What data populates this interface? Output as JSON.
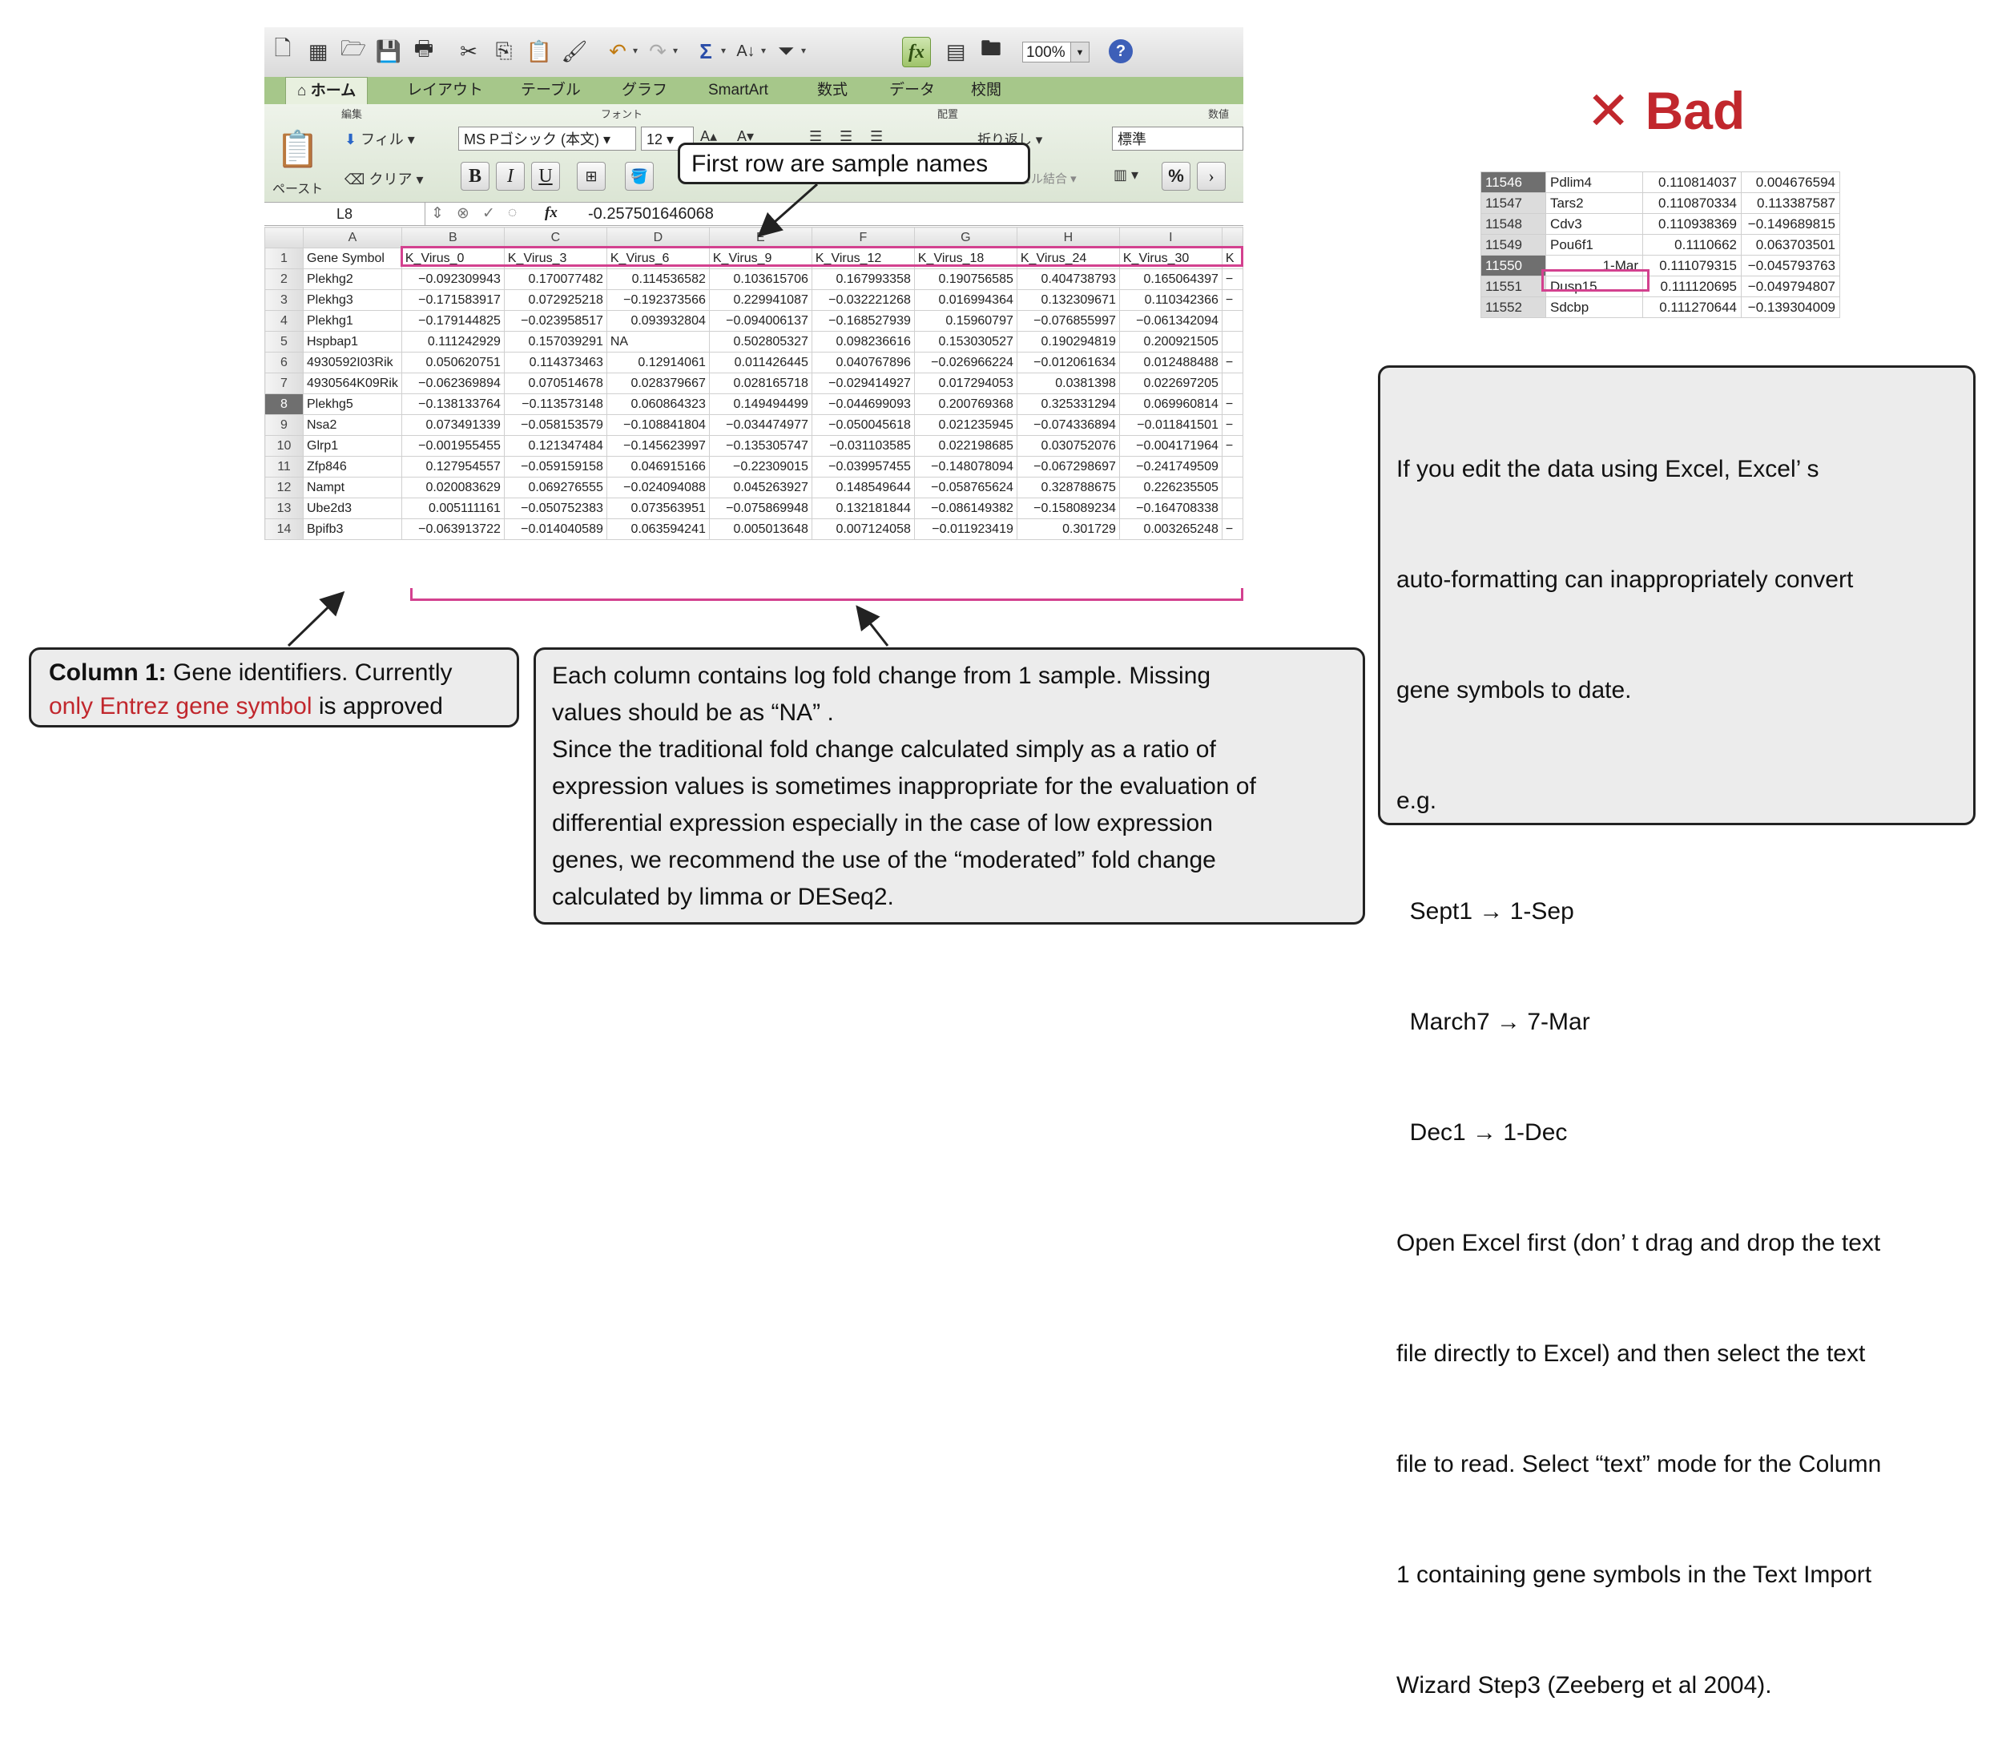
{
  "toolbar": {
    "zoom_value": "100%",
    "icons": [
      "new-icon",
      "gallery-icon",
      "open-icon",
      "save-icon",
      "print-icon",
      "cut-icon",
      "copy-icon",
      "paste-icon",
      "format-painter-icon",
      "undo-icon",
      "redo-icon",
      "autosum-icon",
      "sort-icon",
      "filter-icon",
      "fx-icon",
      "show-toolbox-icon",
      "media-icon",
      "help-icon"
    ],
    "fx_label": "fx",
    "help_label": "?"
  },
  "ribbon": {
    "tabs": [
      "ホーム",
      "レイアウト",
      "テーブル",
      "グラフ",
      "SmartArt",
      "数式",
      "データ",
      "校閲"
    ],
    "group_edit": "編集",
    "group_font": "フォント",
    "group_align": "配置",
    "group_number": "数値",
    "fill_label": "フィル",
    "clear_label": "クリア",
    "paste_label": "ペースト",
    "font_name": "MS Pゴシック (本文)",
    "font_size": "12",
    "bold": "B",
    "italic": "I",
    "underline": "U",
    "wrap_label": "折り返し",
    "merge_label": "セル結合",
    "number_format": "標準",
    "percent_label": "%"
  },
  "formula_bar": {
    "cell_ref": "L8",
    "fx": "fx",
    "value": "-0.257501646068"
  },
  "sheet": {
    "col_letters": [
      "A",
      "B",
      "C",
      "D",
      "E",
      "F",
      "G",
      "H",
      "I"
    ],
    "header_row": [
      "Gene Symbol",
      "K_Virus_0",
      "K_Virus_3",
      "K_Virus_6",
      "K_Virus_9",
      "K_Virus_12",
      "K_Virus_18",
      "K_Virus_24",
      "K_Virus_30",
      "K"
    ],
    "rows": [
      [
        "2",
        "Plekhg2",
        "−0.092309943",
        "0.170077482",
        "0.114536582",
        "0.103615706",
        "0.167993358",
        "0.190756585",
        "0.404738793",
        "0.165064397",
        "−"
      ],
      [
        "3",
        "Plekhg3",
        "−0.171583917",
        "0.072925218",
        "−0.192373566",
        "0.229941087",
        "−0.032221268",
        "0.016994364",
        "0.132309671",
        "0.110342366",
        "−"
      ],
      [
        "4",
        "Plekhg1",
        "−0.179144825",
        "−0.023958517",
        "0.093932804",
        "−0.094006137",
        "−0.168527939",
        "0.15960797",
        "−0.076855997",
        "−0.061342094",
        ""
      ],
      [
        "5",
        "Hspbap1",
        "0.111242929",
        "0.157039291",
        "NA",
        "0.502805327",
        "0.098236616",
        "0.153030527",
        "0.190294819",
        "0.200921505",
        ""
      ],
      [
        "6",
        "4930592I03Rik",
        "0.050620751",
        "0.114373463",
        "0.12914061",
        "0.011426445",
        "0.040767896",
        "−0.026966224",
        "−0.012061634",
        "0.012488488",
        "−"
      ],
      [
        "7",
        "4930564K09Rik",
        "−0.062369894",
        "0.070514678",
        "0.028379667",
        "0.028165718",
        "−0.029414927",
        "0.017294053",
        "0.0381398",
        "0.022697205",
        ""
      ],
      [
        "8",
        "Plekhg5",
        "−0.138133764",
        "−0.113573148",
        "0.060864323",
        "0.149494499",
        "−0.044699093",
        "0.200769368",
        "0.325331294",
        "0.069960814",
        "−"
      ],
      [
        "9",
        "Nsa2",
        "0.073491339",
        "−0.058153579",
        "−0.108841804",
        "−0.034474977",
        "−0.050045618",
        "0.021235945",
        "−0.074336894",
        "−0.011841501",
        "−"
      ],
      [
        "10",
        "Glrp1",
        "−0.001955455",
        "0.121347484",
        "−0.145623997",
        "−0.135305747",
        "−0.031103585",
        "0.022198685",
        "0.030752076",
        "−0.004171964",
        "−"
      ],
      [
        "11",
        "Zfp846",
        "0.127954557",
        "−0.059159158",
        "0.046915166",
        "−0.22309015",
        "−0.039957455",
        "−0.148078094",
        "−0.067298697",
        "−0.241749509",
        ""
      ],
      [
        "12",
        "Nampt",
        "0.020083629",
        "0.069276555",
        "−0.024094088",
        "0.045263927",
        "0.148549644",
        "−0.058765624",
        "0.328788675",
        "0.226235505",
        ""
      ],
      [
        "13",
        "Ube2d3",
        "0.005111161",
        "−0.050752383",
        "0.073563951",
        "−0.075869948",
        "0.132181844",
        "−0.086149382",
        "−0.158089234",
        "−0.164708338",
        ""
      ],
      [
        "14",
        "Bpifb3",
        "−0.063913722",
        "−0.014040589",
        "0.063594241",
        "0.005013648",
        "0.007124058",
        "−0.011923419",
        "0.301729",
        "0.003265248",
        "−"
      ]
    ]
  },
  "callouts": {
    "first_row": "First row are sample names",
    "col1_bold": "Column 1:",
    "col1_text": " Gene identifiers. Currently",
    "col1_red": "only Entrez gene symbol",
    "col1_tail": " is approved",
    "columns_lines": [
      "Each column contains log fold change from 1 sample. Missing",
      "values should be as “NA” .",
      "Since the traditional fold change calculated simply as a ratio of",
      "expression values is sometimes inappropriate for the evaluation of",
      "differential expression especially in the case of low expression",
      "genes, we recommend the use of the “moderated” fold change",
      "calculated by limma or DESeq2."
    ],
    "excel_lines": [
      "If you edit the data using Excel, Excel’ s",
      "auto-formatting can inappropriately convert",
      "gene symbols to date.",
      "e.g.",
      "  Sept1 → 1-Sep",
      "  March7 → 7-Mar",
      "  Dec1 → 1-Dec",
      "Open Excel first (don’ t drag and drop the text",
      "file directly to Excel) and then select the text",
      "file to read. Select “text” mode for the Column",
      "1 containing gene symbols in the Text Import",
      "Wizard Step3 (Zeeberg et al 2004)."
    ]
  },
  "bad": {
    "label": "✕ Bad",
    "rows": [
      [
        "11546",
        "Pdlim4",
        "0.110814037",
        "0.004676594"
      ],
      [
        "11547",
        "Tars2",
        "0.110870334",
        "0.113387587"
      ],
      [
        "11548",
        "Cdv3",
        "0.110938369",
        "−0.149689815"
      ],
      [
        "11549",
        "Pou6f1",
        "0.1110662",
        "0.063703501"
      ],
      [
        "11550",
        "1-Mar",
        "0.111079315",
        "−0.045793763"
      ],
      [
        "11551",
        "Dusp15",
        "0.111120695",
        "−0.049794807"
      ],
      [
        "11552",
        "Sdcbp",
        "0.111270644",
        "−0.139304009"
      ]
    ]
  },
  "colors": {
    "accent_pink": "#d3418f",
    "bad_red": "#c1272d",
    "ribbon_green": "#a6c78a"
  }
}
